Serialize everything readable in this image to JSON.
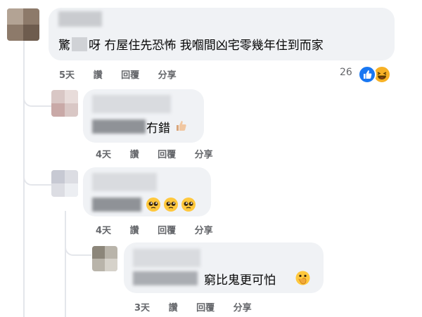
{
  "comments": [
    {
      "text_before": "驚",
      "text_after": "呀 冇屋住先恐怖 我嗰間凶宅零幾年住到而家",
      "time": "5天",
      "like_label": "讚",
      "reply_label": "回覆",
      "share_label": "分享",
      "reaction_count": "26"
    },
    {
      "text": "冇錯",
      "time": "4天",
      "like_label": "讚",
      "reply_label": "回覆",
      "share_label": "分享"
    },
    {
      "time": "4天",
      "like_label": "讚",
      "reply_label": "回覆",
      "share_label": "分享"
    },
    {
      "text": "窮比鬼更可怕",
      "time": "3天",
      "like_label": "讚",
      "reply_label": "回覆",
      "share_label": "分享"
    }
  ],
  "icons": {
    "like": "like-reaction-icon",
    "haha": "haha-reaction-icon",
    "thumbs_up": "thumbs-up-emoji-icon",
    "pleading": "pleading-face-emoji-icon",
    "hand_over_mouth": "hand-over-mouth-emoji-icon"
  },
  "colors": {
    "bubble": "#f0f2f5",
    "meta": "#65676b",
    "like_blue": "#1877f2"
  }
}
